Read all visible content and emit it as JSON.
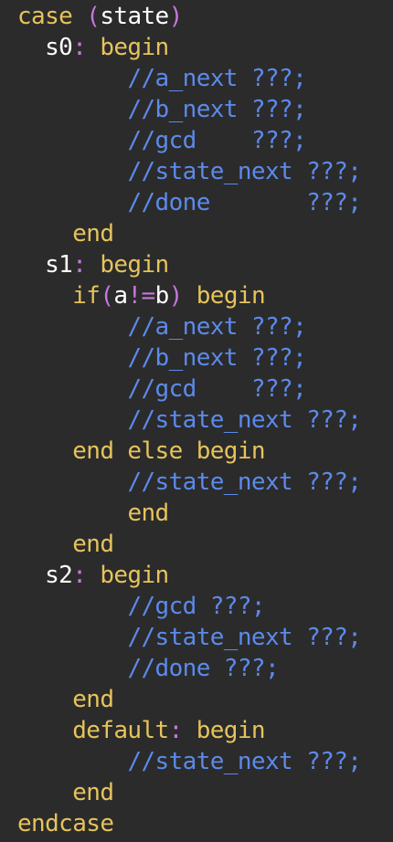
{
  "lines": [
    [
      {
        "t": "case ",
        "k": "k"
      },
      {
        "t": "(",
        "k": "p"
      },
      {
        "t": "state",
        "k": "i"
      },
      {
        "t": ")",
        "k": "p"
      }
    ],
    [
      {
        "t": "  ",
        "k": "i"
      },
      {
        "t": "s0",
        "k": "i"
      },
      {
        "t": ": ",
        "k": "p"
      },
      {
        "t": "begin",
        "k": "k"
      }
    ],
    [
      {
        "t": "        ",
        "k": "i"
      },
      {
        "t": "//a_next ???;",
        "k": "c"
      }
    ],
    [
      {
        "t": "        ",
        "k": "i"
      },
      {
        "t": "//b_next ???;",
        "k": "c"
      }
    ],
    [
      {
        "t": "        ",
        "k": "i"
      },
      {
        "t": "//gcd    ???;",
        "k": "c"
      }
    ],
    [
      {
        "t": "        ",
        "k": "i"
      },
      {
        "t": "//state_next ???;",
        "k": "c"
      }
    ],
    [
      {
        "t": "        ",
        "k": "i"
      },
      {
        "t": "//done       ???;",
        "k": "c"
      }
    ],
    [
      {
        "t": "    ",
        "k": "i"
      },
      {
        "t": "end",
        "k": "k"
      }
    ],
    [
      {
        "t": "  ",
        "k": "i"
      },
      {
        "t": "s1",
        "k": "i"
      },
      {
        "t": ": ",
        "k": "p"
      },
      {
        "t": "begin",
        "k": "k"
      }
    ],
    [
      {
        "t": "    ",
        "k": "i"
      },
      {
        "t": "if",
        "k": "k"
      },
      {
        "t": "(",
        "k": "p"
      },
      {
        "t": "a",
        "k": "i"
      },
      {
        "t": "!=",
        "k": "p"
      },
      {
        "t": "b",
        "k": "i"
      },
      {
        "t": ") ",
        "k": "p"
      },
      {
        "t": "begin",
        "k": "k"
      }
    ],
    [
      {
        "t": "        ",
        "k": "i"
      },
      {
        "t": "//a_next ???;",
        "k": "c"
      }
    ],
    [
      {
        "t": "        ",
        "k": "i"
      },
      {
        "t": "//b_next ???;",
        "k": "c"
      }
    ],
    [
      {
        "t": "        ",
        "k": "i"
      },
      {
        "t": "//gcd    ???;",
        "k": "c"
      }
    ],
    [
      {
        "t": "        ",
        "k": "i"
      },
      {
        "t": "//state_next ???;",
        "k": "c"
      }
    ],
    [
      {
        "t": "    ",
        "k": "i"
      },
      {
        "t": "end else begin",
        "k": "k"
      }
    ],
    [
      {
        "t": "        ",
        "k": "i"
      },
      {
        "t": "//state_next ???;",
        "k": "c"
      }
    ],
    [
      {
        "t": "        ",
        "k": "i"
      },
      {
        "t": "end",
        "k": "k"
      }
    ],
    [
      {
        "t": "    ",
        "k": "i"
      },
      {
        "t": "end",
        "k": "k"
      }
    ],
    [
      {
        "t": "  ",
        "k": "i"
      },
      {
        "t": "s2",
        "k": "i"
      },
      {
        "t": ": ",
        "k": "p"
      },
      {
        "t": "begin",
        "k": "k"
      }
    ],
    [
      {
        "t": "        ",
        "k": "i"
      },
      {
        "t": "//gcd ???;",
        "k": "c"
      }
    ],
    [
      {
        "t": "        ",
        "k": "i"
      },
      {
        "t": "//state_next ???;",
        "k": "c"
      }
    ],
    [
      {
        "t": "        ",
        "k": "i"
      },
      {
        "t": "//done ???;",
        "k": "c"
      }
    ],
    [
      {
        "t": "    ",
        "k": "i"
      },
      {
        "t": "end",
        "k": "k"
      }
    ],
    [
      {
        "t": "    ",
        "k": "i"
      },
      {
        "t": "default",
        "k": "k"
      },
      {
        "t": ": ",
        "k": "p"
      },
      {
        "t": "begin",
        "k": "k"
      }
    ],
    [
      {
        "t": "        ",
        "k": "i"
      },
      {
        "t": "//state_next ???;",
        "k": "c"
      }
    ],
    [
      {
        "t": "    ",
        "k": "i"
      },
      {
        "t": "end",
        "k": "k"
      }
    ],
    [
      {
        "t": "endcase",
        "k": "k"
      }
    ]
  ],
  "colors": {
    "background": "#2b2b2b",
    "keyword": "#e6c35c",
    "identifier": "#ffffff",
    "punctuation": "#c678dd",
    "comment": "#5c8aeb"
  }
}
